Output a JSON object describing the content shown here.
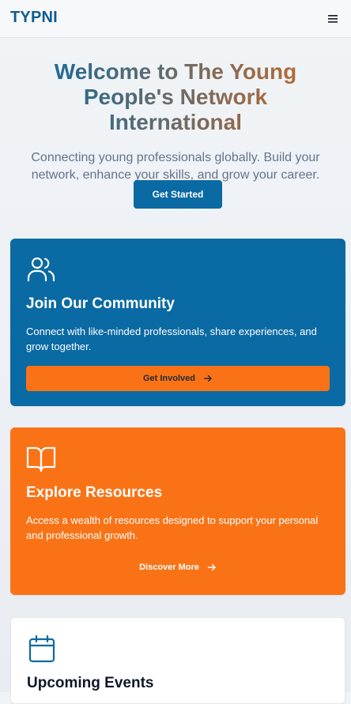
{
  "header": {
    "brand": "TYPNI",
    "menu_icon": "hamburger-menu-icon"
  },
  "hero": {
    "title": "Welcome to The Young People's Network International",
    "subtitle": "Connecting young professionals globally. Build your network, enhance your skills, and grow your career.",
    "cta_label": "Get Started"
  },
  "cards": [
    {
      "icon": "users-icon",
      "title": "Join Our Community",
      "text": "Connect with like-minded professionals, share experiences, and grow together.",
      "button_label": "Get Involved",
      "button_icon": "arrow-right-icon"
    },
    {
      "icon": "book-open-icon",
      "title": "Explore Resources",
      "text": "Access a wealth of resources designed to support your personal and professional growth.",
      "button_label": "Discover More",
      "button_icon": "arrow-right-icon"
    },
    {
      "icon": "calendar-icon",
      "title": "Upcoming Events"
    }
  ],
  "colors": {
    "primary_blue": "#0a6aa3",
    "accent_orange": "#f97316",
    "brand_text": "#0f5c8f",
    "title_gradient_start": "#0f6aa0",
    "title_gradient_end": "#c76b2b"
  }
}
